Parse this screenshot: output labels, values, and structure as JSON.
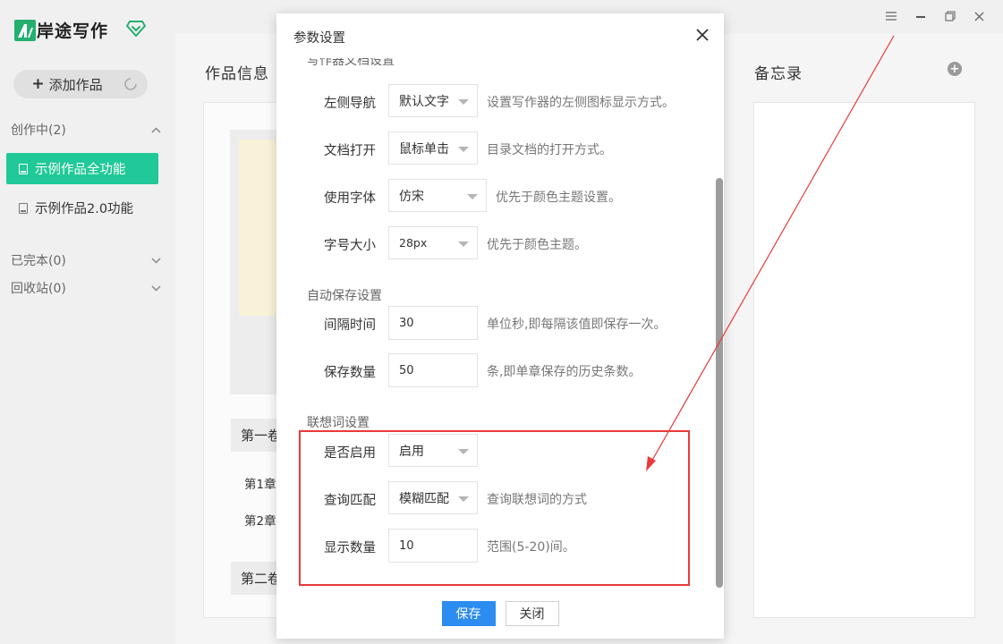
{
  "app": {
    "logo_text": "岸途写作"
  },
  "sidebar": {
    "add_label": "添加作品",
    "groups": [
      {
        "label": "创作中(2)"
      },
      {
        "label": "已完本(0)"
      },
      {
        "label": "回收站(0)"
      }
    ],
    "works": [
      {
        "label": "示例作品全功能",
        "active": true
      },
      {
        "label": "示例作品2.0功能",
        "active": false
      }
    ]
  },
  "main": {
    "info_title": "作品信息",
    "memo_title": "备忘录",
    "volumes": [
      "第一卷",
      "第二卷"
    ],
    "chapters": [
      "第1章",
      "第2章"
    ]
  },
  "modal": {
    "title": "参数设置",
    "sections": {
      "editor_doc": "写作器文档设置",
      "autosave": "自动保存设置",
      "suggest": "联想词设置"
    },
    "rows": {
      "left_nav": {
        "label": "左侧导航",
        "value": "默认文字",
        "hint": "设置写作器的左侧图标显示方式。"
      },
      "doc_open": {
        "label": "文档打开",
        "value": "鼠标单击",
        "hint": "目录文档的打开方式。"
      },
      "font": {
        "label": "使用字体",
        "value": "仿宋",
        "hint": "优先于颜色主题设置。"
      },
      "font_size": {
        "label": "字号大小",
        "value": "28px",
        "hint": "优先于颜色主题。"
      },
      "interval": {
        "label": "间隔时间",
        "value": "30",
        "hint": "单位秒,即每隔该值即保存一次。"
      },
      "save_count": {
        "label": "保存数量",
        "value": "50",
        "hint": "条,即单章保存的历史条数。"
      },
      "enabled": {
        "label": "是否启用",
        "value": "启用",
        "hint": ""
      },
      "match": {
        "label": "查询匹配",
        "value": "模糊匹配",
        "hint": "查询联想词的方式"
      },
      "show_count": {
        "label": "显示数量",
        "value": "10",
        "hint": "范围(5-20)间。"
      }
    },
    "save_label": "保存",
    "close_label": "关闭"
  },
  "colors": {
    "brand": "#23b06f",
    "active_item": "#20c997",
    "primary_button": "#2d8cf0",
    "annotation": "#e83a3a"
  }
}
